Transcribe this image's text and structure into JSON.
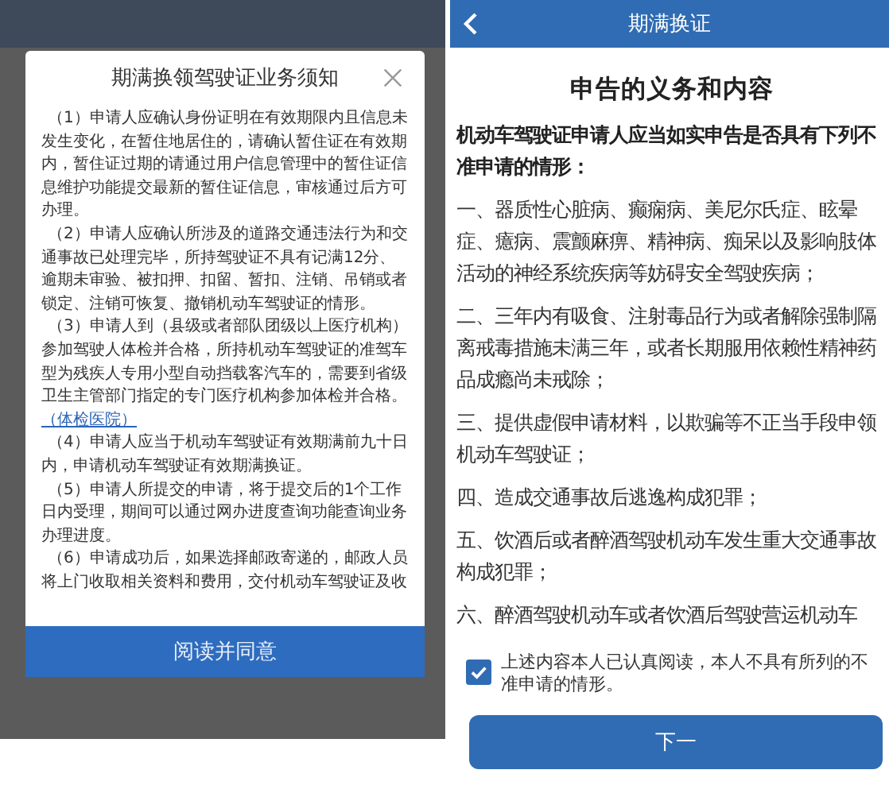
{
  "notice_screen": {
    "dialog": {
      "title": "期满换领驾驶证业务须知",
      "paragraphs": [
        {
          "text": "（1）申请人应确认身份证明在有效期限内且信息未发生变化，在暂住地居住的，请确认暂住证在有效期内，暂住证过期的请通过用户信息管理中的暂住证信息维护功能提交最新的暂住证信息，审核通过后方可办理。"
        },
        {
          "text": "（2）申请人应确认所涉及的道路交通违法行为和交通事故已处理完毕，所持驾驶证不具有记满12分、逾期未审验、被扣押、扣留、暂扣、注销、吊销或者锁定、注销可恢复、撤销机动车驾驶证的情形。"
        },
        {
          "text": "（3）申请人到（县级或者部队团级以上医疗机构）参加驾驶人体检并合格，所持机动车驾驶证的准驾车型为残疾人专用小型自动挡载客汽车的，需要到省级卫生主管部门指定的专门医疗机构参加体检并合格。",
          "link": "（体检医院）"
        },
        {
          "text": "（4）申请人应当于机动车驾驶证有效期满前九十日内，申请机动车驾驶证有效期满换证。"
        },
        {
          "text": "（5）申请人所提交的申请，将于提交后的1个工作日内受理，期间可以通过网办进度查询功能查询业务办理进度。"
        },
        {
          "text": "（6）申请成功后，如果选择邮政寄递的，邮政人员将上门收取相关资料和费用，交付机动车驾驶证及收"
        }
      ],
      "button": "阅读并同意"
    }
  },
  "declaration_screen": {
    "header": {
      "title": "期满换证"
    },
    "heading": "申告的义务和内容",
    "intro": "机动车驾驶证申请人应当如实申告是否具有下列不准申请的情形：",
    "items": [
      "一、器质性心脏病、癫痫病、美尼尔氏症、眩晕症、癔病、震颤麻痹、精神病、痴呆以及影响肢体活动的神经系统疾病等妨碍安全驾驶疾病；",
      "二、三年内有吸食、注射毒品行为或者解除强制隔离戒毒措施未满三年，或者长期服用依赖性精神药品成瘾尚未戒除；",
      "三、提供虚假申请材料，以欺骗等不正当手段申领机动车驾驶证；",
      "四、造成交通事故后逃逸构成犯罪；",
      "五、饮酒后或者醉酒驾驶机动车发生重大交通事故构成犯罪；",
      "六、醉酒驾驶机动车或者饮酒后驾驶营运机动车"
    ],
    "agreement": {
      "checked": true,
      "text": "上述内容本人已认真阅读，本人不具有所列的不准申请的情形。"
    },
    "button": "下一"
  }
}
